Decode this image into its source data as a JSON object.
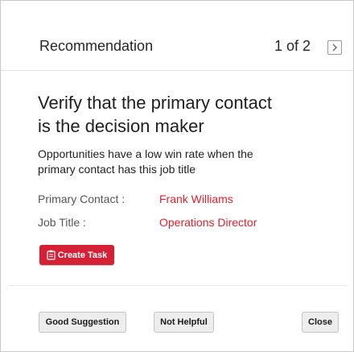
{
  "header": {
    "title": "Recommendation",
    "pager": "1 of 2",
    "next_icon": "chevron-right-icon"
  },
  "recommendation": {
    "headline_line1": "Verify that the primary contact",
    "headline_line2": "is the decision maker",
    "description_line1": "Opportunities have a low win rate when the",
    "description_line2": "primary contact has this job title"
  },
  "fields": [
    {
      "label": "Primary Contact :",
      "value": "Frank Williams"
    },
    {
      "label": "Job Title :",
      "value": "Operations Director"
    }
  ],
  "actions": {
    "create_task_label": "Create Task",
    "create_task_icon": "clipboard-icon"
  },
  "footer": {
    "good_suggestion_label": "Good Suggestion",
    "not_helpful_label": "Not Helpful",
    "close_label": "Close"
  },
  "colors": {
    "accent_red": "#d52135",
    "value_red": "#e1202b"
  }
}
